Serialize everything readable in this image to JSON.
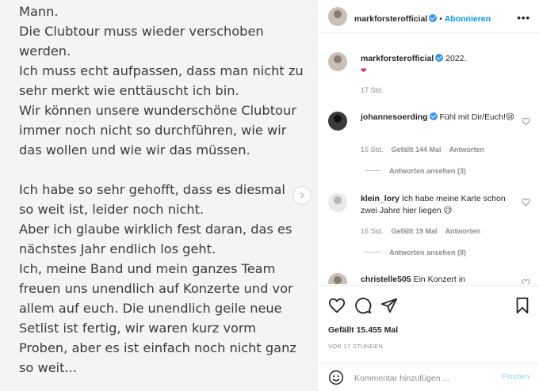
{
  "post": {
    "lines": [
      "Mann.",
      "Die Clubtour muss wieder verschoben",
      "werden.",
      "Ich muss echt aufpassen, dass man nicht zu",
      "sehr merkt wie enttäuscht ich bin.",
      "Wir können unsere wunderschöne Clubtour",
      "immer noch nicht so durchführen, wie wir",
      "das wollen und wie wir das müssen.",
      "",
      "Ich habe so sehr gehofft, dass es diesmal",
      "so weit ist, leider noch nicht.",
      "Aber ich glaube wirklich fest daran, das es",
      "nächstes Jahr endlich los geht.",
      "Ich, meine Band und mein ganzes Team",
      "freuen uns unendlich auf Konzerte und vor",
      "allem auf euch. Die unendlich geile neue",
      "Setlist ist fertig, wir waren kurz vorm",
      "Proben, aber es ist einfach noch nicht ganz",
      "so weit..."
    ]
  },
  "header": {
    "username": "markforsterofficial",
    "separator": "•",
    "follow_label": "Abonnieren",
    "more_icon": "more-options-icon"
  },
  "caption": {
    "username": "markforsterofficial",
    "text": "2022.",
    "emoji": "❤",
    "time": "17 Std."
  },
  "comments": [
    {
      "username": "johannesoerding",
      "verified": true,
      "text": "Fühl mit Dir/Euch!😢",
      "time": "16 Std.",
      "likes": "Gefällt 144 Mal",
      "reply_label": "Antworten",
      "view_replies": "Antworten ansehen (3)"
    },
    {
      "username": "klein_lory",
      "verified": false,
      "text": "Ich habe meine Karte schon zwei Jahre hier liegen 😥",
      "time": "16 Std.",
      "likes": "Gefällt 19 Mal",
      "reply_label": "Antworten",
      "view_replies": "Antworten ansehen (8)"
    },
    {
      "username": "christelle505",
      "verified": false,
      "text": "Ein Konzert in"
    }
  ],
  "actions": {
    "likes": "Gefällt 15.455 Mal",
    "time": "VOR 17 STUNDEN"
  },
  "add_comment": {
    "placeholder": "Kommentar hinzufügen ...",
    "post_label": "Posten"
  },
  "colors": {
    "link": "#0095f6",
    "verified": "#3897f0",
    "muted": "#8e8e8e",
    "post_disabled": "#b2dffc"
  }
}
